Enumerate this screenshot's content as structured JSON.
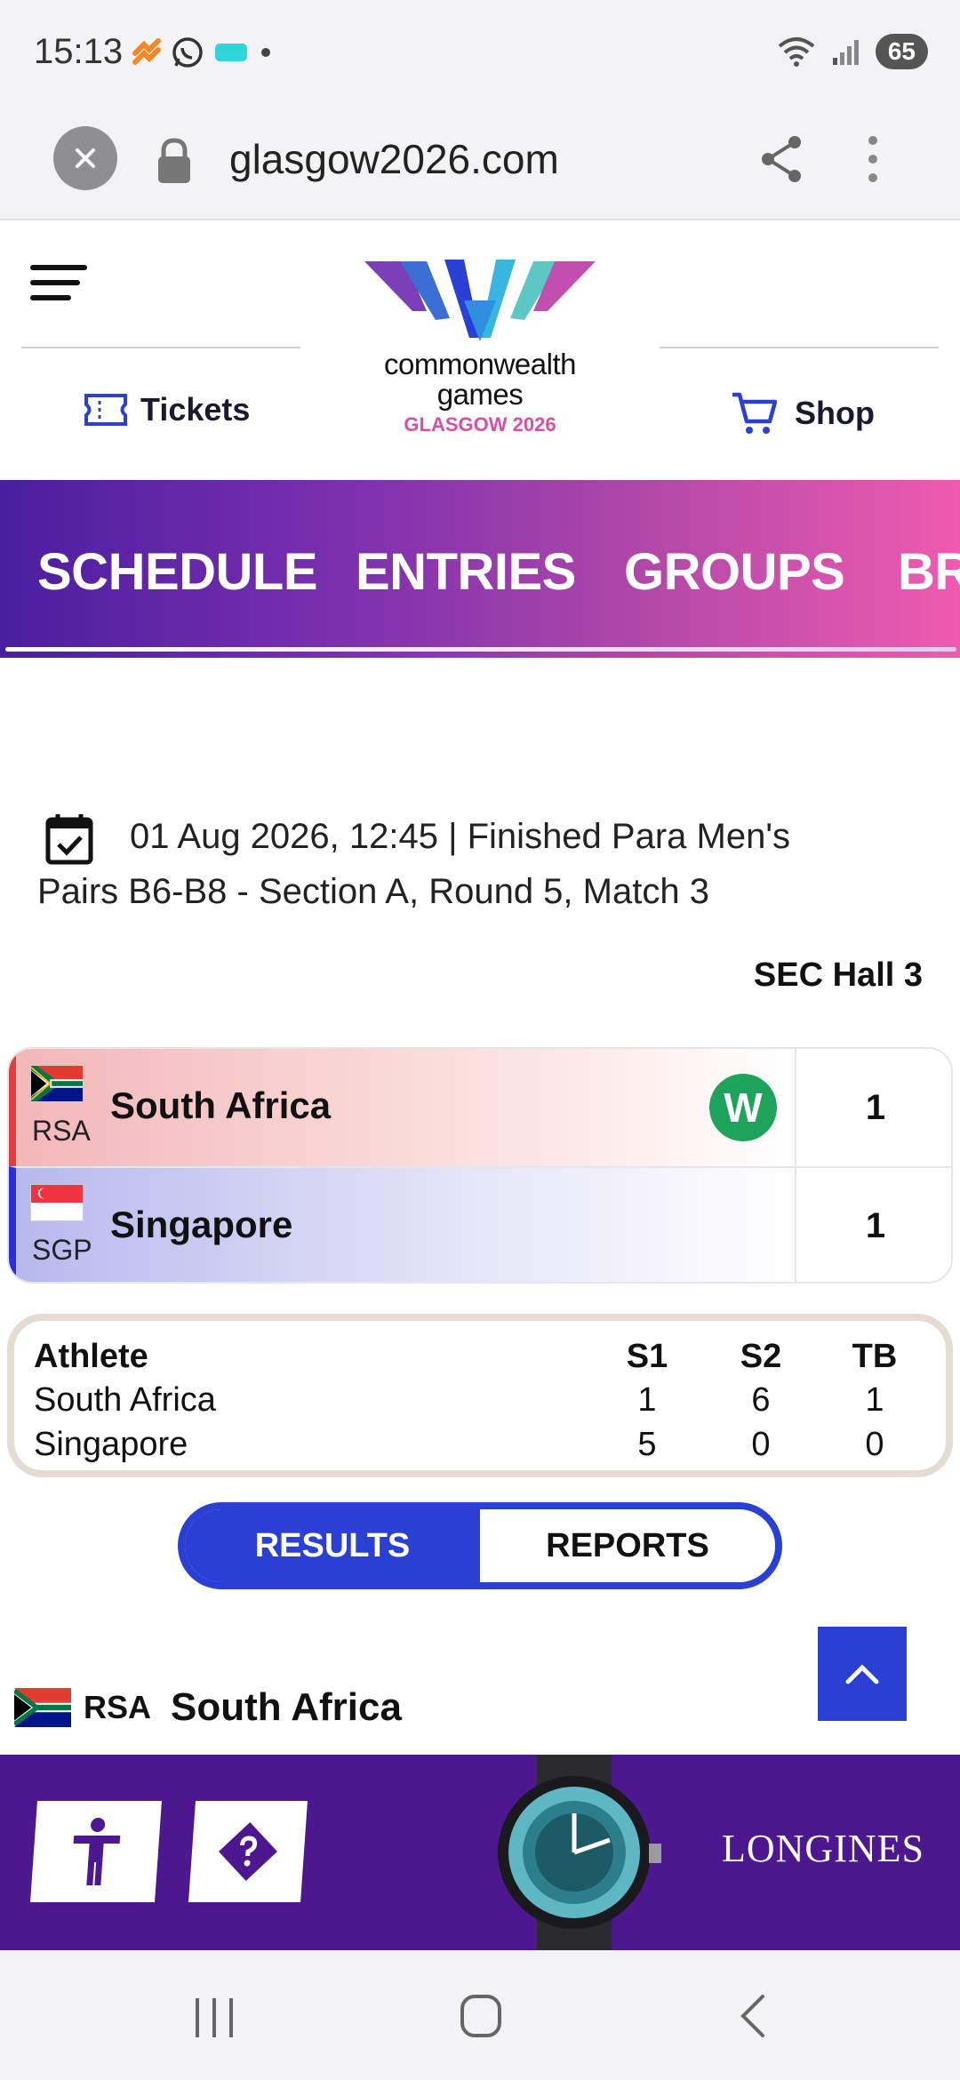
{
  "status_bar": {
    "time": "15:13",
    "battery": "65",
    "icons": [
      "notification-icon",
      "whatsapp-icon",
      "app-icon",
      "wifi-icon",
      "signal-icon",
      "battery-icon"
    ]
  },
  "browser": {
    "url": "glasgow2026.com"
  },
  "header": {
    "logo_line1": "commonwealth",
    "logo_line2": "games",
    "logo_line3": "GLASGOW 2026",
    "tickets_label": "Tickets",
    "shop_label": "Shop"
  },
  "nav_tabs": [
    "SCHEDULE",
    "ENTRIES",
    "GROUPS",
    "BR"
  ],
  "match": {
    "line1": "01 Aug 2026, 12:45  |  Finished     Para Men's",
    "line2": "Pairs B6-B8 - Section A, Round 5, Match 3",
    "venue": "SEC Hall 3"
  },
  "scorecard": {
    "teams": [
      {
        "code": "RSA",
        "name": "South Africa",
        "score": "1",
        "winner_badge": "W"
      },
      {
        "code": "SGP",
        "name": "Singapore",
        "score": "1"
      }
    ]
  },
  "sets_table": {
    "headers": [
      "Athlete",
      "S1",
      "S2",
      "TB"
    ],
    "rows": [
      [
        "South Africa",
        "1",
        "6",
        "1"
      ],
      [
        "Singapore",
        "5",
        "0",
        "0"
      ]
    ]
  },
  "toggle": {
    "results": "RESULTS",
    "reports": "REPORTS"
  },
  "section": {
    "code": "RSA",
    "name": "South Africa"
  },
  "ad": {
    "brand": "LONGINES"
  },
  "colors": {
    "accent_blue": "#2a3fd4",
    "nav_gradient_start": "#4a1ea0",
    "nav_gradient_end": "#ef5bb0",
    "ad_purple": "#4d178f",
    "win_green": "#1ea35a",
    "logo_pink": "#d94fa7"
  }
}
